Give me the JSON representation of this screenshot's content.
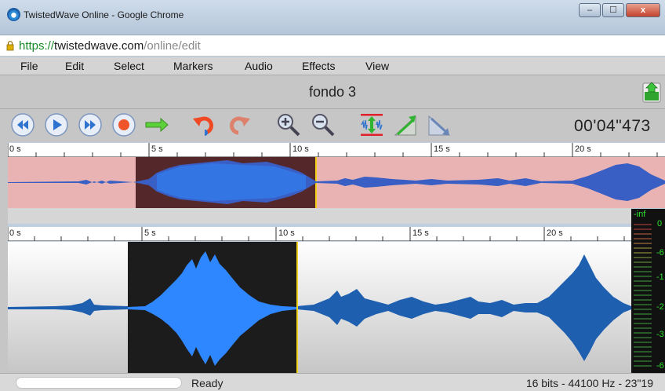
{
  "window": {
    "title": "TwistedWave Online - Google Chrome",
    "controls": {
      "minimize": "–",
      "maximize": "☐",
      "close": "x"
    }
  },
  "address": {
    "scheme": "https://",
    "host": "twistedwave.com",
    "path": "/online/edit"
  },
  "menu": [
    "File",
    "Edit",
    "Select",
    "Markers",
    "Audio",
    "Effects",
    "View"
  ],
  "document": {
    "title": "fondo 3"
  },
  "toolbar": {
    "buttons": [
      {
        "name": "rewind-button",
        "icon": "rewind-icon"
      },
      {
        "name": "play-button",
        "icon": "play-icon"
      },
      {
        "name": "fast-forward-button",
        "icon": "fast-forward-icon"
      },
      {
        "name": "record-button",
        "icon": "record-icon"
      },
      {
        "name": "play-selection-button",
        "icon": "arrow-right-icon"
      },
      {
        "name": "undo-button",
        "icon": "undo-icon"
      },
      {
        "name": "redo-button",
        "icon": "redo-icon"
      },
      {
        "name": "zoom-in-button",
        "icon": "zoom-in-icon"
      },
      {
        "name": "zoom-out-button",
        "icon": "zoom-out-icon"
      },
      {
        "name": "normalize-button",
        "icon": "normalize-icon"
      },
      {
        "name": "fade-in-button",
        "icon": "fade-in-icon"
      },
      {
        "name": "fade-out-button",
        "icon": "fade-out-icon"
      }
    ],
    "time": "00'04\"473"
  },
  "overview_ruler": {
    "ticks": [
      "0 s",
      "5 s",
      "10 s",
      "15 s",
      "20 s"
    ]
  },
  "main_ruler": {
    "ticks": [
      "0 s",
      "5 s",
      "10 s",
      "15 s",
      "20 s"
    ]
  },
  "meter": {
    "labels": [
      "-inf",
      "0",
      "-6",
      "-1",
      "-2",
      "-3",
      "-6"
    ]
  },
  "status": {
    "ready": "Ready",
    "info": "16 bits - 44100 Hz - 23\"19"
  },
  "colors": {
    "wave_main": "#1f5fb0",
    "wave_selected": "#2f87ff",
    "overview_bg": "#e9b3b3",
    "overview_sel": "#54282a",
    "cursor": "#f3d31a",
    "meter_green": "#2ee32e"
  }
}
